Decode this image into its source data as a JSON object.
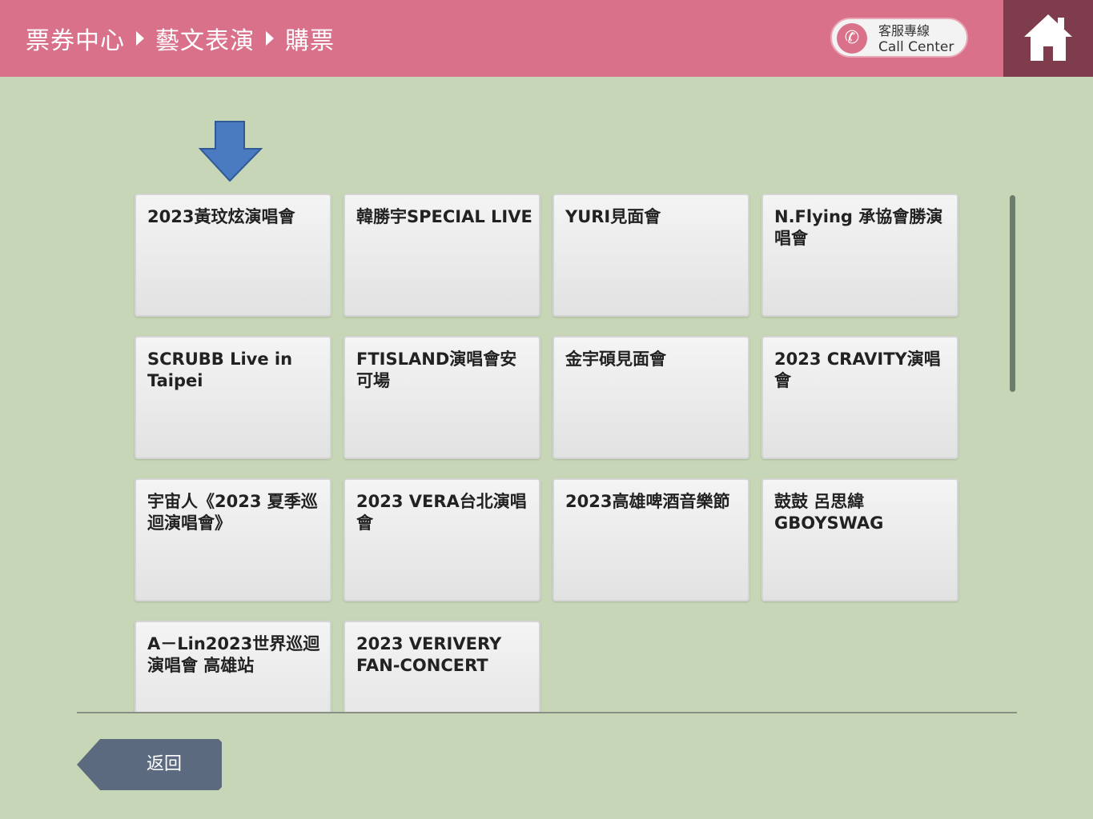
{
  "header": {
    "breadcrumb": [
      "票券中心",
      "藝文表演",
      "購票"
    ],
    "call_center_zh": "客服專線",
    "call_center_en": "Call Center",
    "call_icon": "phone-icon",
    "home_icon": "home-icon"
  },
  "events": [
    "2023黃玟炫演唱會",
    "韓勝宇SPECIAL LIVE",
    "YURI見面會",
    "N.Flying 承協會勝演唱會",
    "SCRUBB Live in Taipei",
    "FTISLAND演唱會安可場",
    "金宇碩見面會",
    "2023 CRAVITY演唱會",
    "宇宙人《2023 夏季巡迴演唱會》",
    "2023 VERA台北演唱會",
    "2023高雄啤酒音樂節",
    "鼓鼓 呂思緯 GBOYSWAG",
    "A－Lin2023世界巡迴演唱會 高雄站",
    "2023 VERIVERY FAN-CONCERT"
  ],
  "back_button": "返回",
  "colors": {
    "header": "#d9718b",
    "home_box": "#7e3c4c",
    "background": "#c6d6b6",
    "arrow": "#4a7bc0",
    "back_button": "#5c6a80"
  }
}
